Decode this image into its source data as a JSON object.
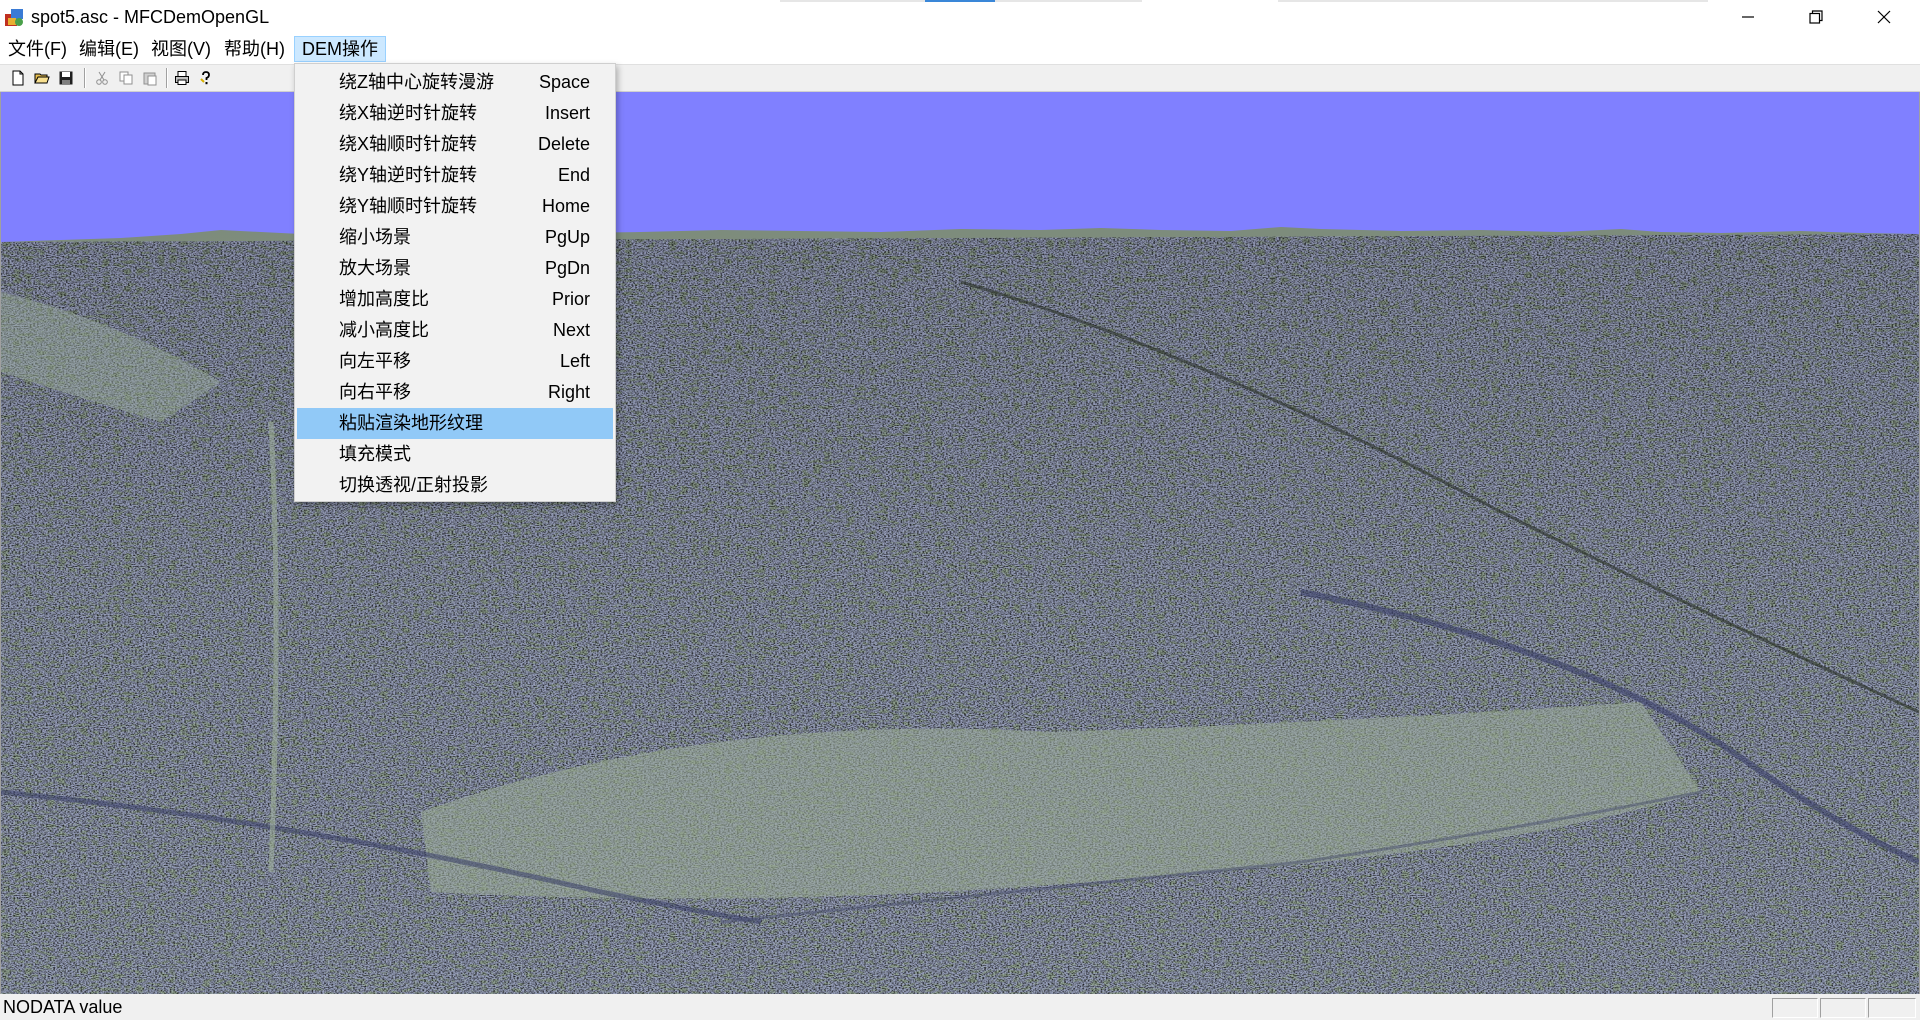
{
  "window": {
    "title": "spot5.asc - MFCDemOpenGL"
  },
  "menubar": {
    "items": [
      {
        "label": "文件(F)"
      },
      {
        "label": "编辑(E)"
      },
      {
        "label": "视图(V)"
      },
      {
        "label": "帮助(H)"
      },
      {
        "label": "DEM操作"
      }
    ],
    "active": "DEM操作"
  },
  "dem_menu": {
    "items": [
      {
        "label": "绕Z轴中心旋转漫游",
        "key": "Space"
      },
      {
        "label": "绕X轴逆时针旋转",
        "key": "Insert"
      },
      {
        "label": "绕X轴顺时针旋转",
        "key": "Delete"
      },
      {
        "label": "绕Y轴逆时针旋转",
        "key": "End"
      },
      {
        "label": "绕Y轴顺时针旋转",
        "key": "Home"
      },
      {
        "label": "缩小场景",
        "key": "PgUp"
      },
      {
        "label": "放大场景",
        "key": "PgDn"
      },
      {
        "label": "增加高度比",
        "key": "Prior"
      },
      {
        "label": "减小高度比",
        "key": "Next"
      },
      {
        "label": "向左平移",
        "key": "Left"
      },
      {
        "label": "向右平移",
        "key": "Right"
      },
      {
        "label": "粘贴渲染地形纹理",
        "key": ""
      },
      {
        "label": "填充模式",
        "key": ""
      },
      {
        "label": "切换透视/正射投影",
        "key": ""
      }
    ],
    "highlighted": "粘贴渲染地形纹理"
  },
  "toolbar": {
    "buttons": [
      "new-file-icon",
      "open-folder-icon",
      "save-disk-icon",
      "cut-icon",
      "copy-icon",
      "paste-icon",
      "print-icon",
      "help-icon"
    ]
  },
  "viewport": {
    "sky_color": "#8080ff",
    "terrain_color": "#8a9b8a"
  },
  "statusbar": {
    "text": "NODATA value"
  }
}
